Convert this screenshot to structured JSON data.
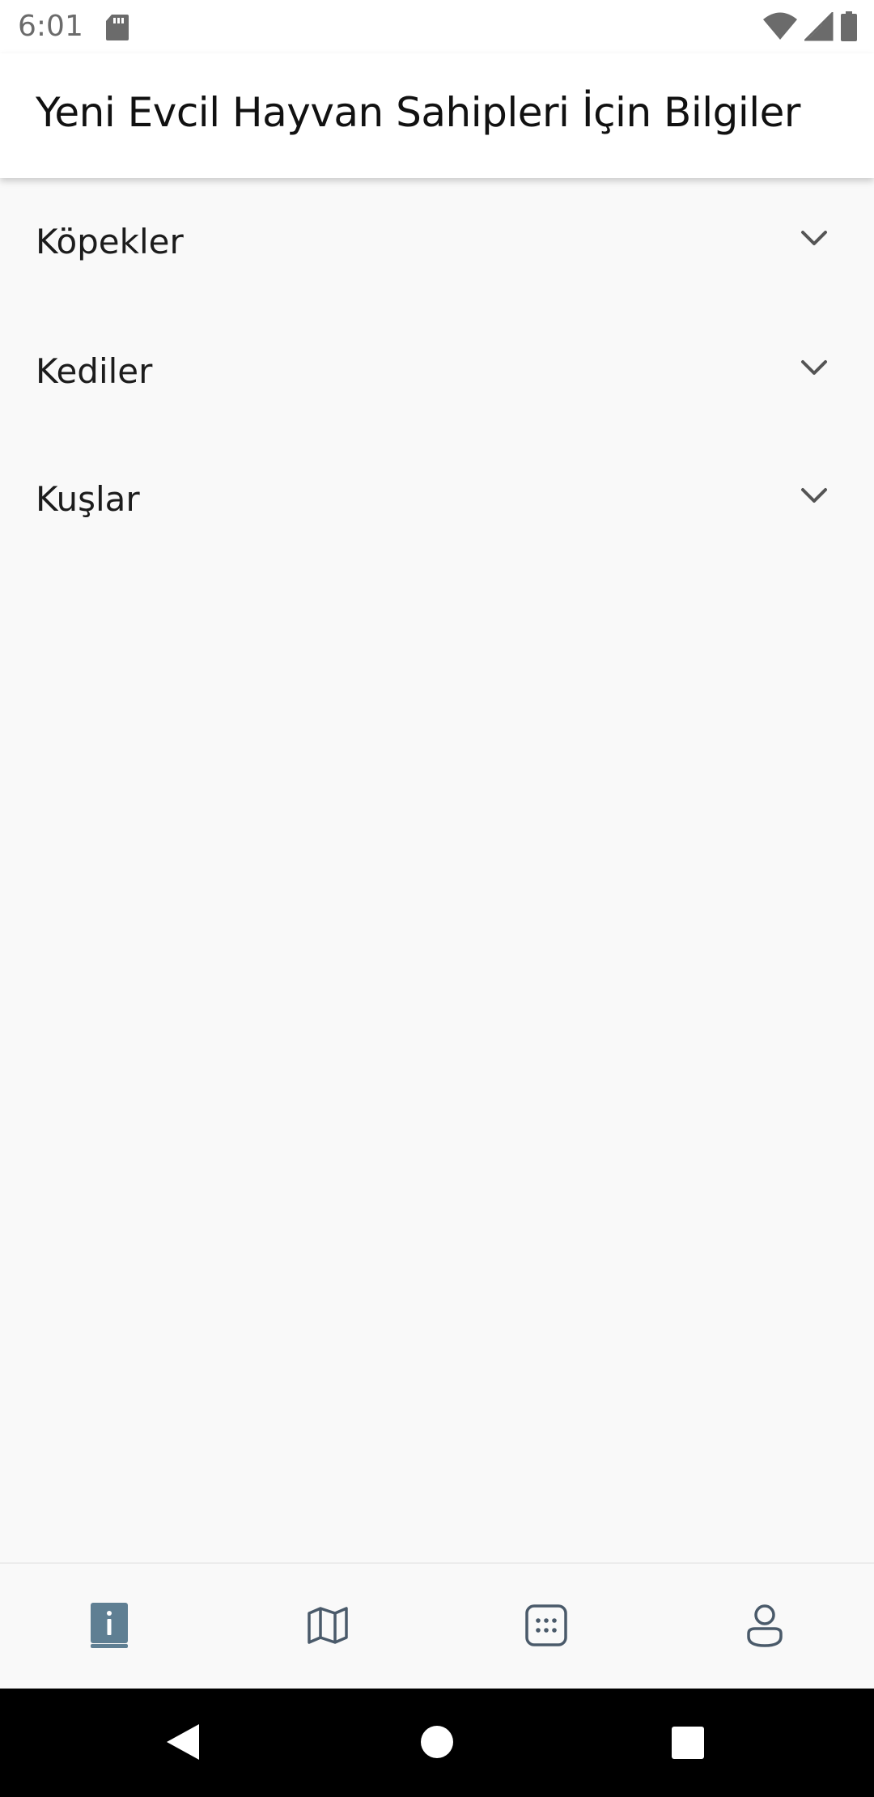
{
  "status_bar": {
    "time": "6:01",
    "icons": [
      "sd-card-icon",
      "wifi-icon",
      "signal-icon",
      "battery-icon"
    ]
  },
  "app_bar": {
    "title": "Yeni Evcil Hayvan Sahipleri İçin Bilgiler"
  },
  "accordion": {
    "items": [
      {
        "label": "Köpekler",
        "icon": "chevron-down-icon"
      },
      {
        "label": "Kediler",
        "icon": "chevron-down-icon"
      },
      {
        "label": "Kuşlar",
        "icon": "chevron-down-icon"
      }
    ]
  },
  "bottom_nav": {
    "items": [
      {
        "icon": "info-book-icon",
        "active": true
      },
      {
        "icon": "map-icon",
        "active": false
      },
      {
        "icon": "grid-dots-icon",
        "active": false
      },
      {
        "icon": "profile-icon",
        "active": false
      }
    ],
    "colors": {
      "active": "#5f7f93",
      "inactive": "#4a5a6a"
    }
  },
  "system_nav": {
    "buttons": [
      "back-icon",
      "home-icon",
      "recents-icon"
    ]
  }
}
